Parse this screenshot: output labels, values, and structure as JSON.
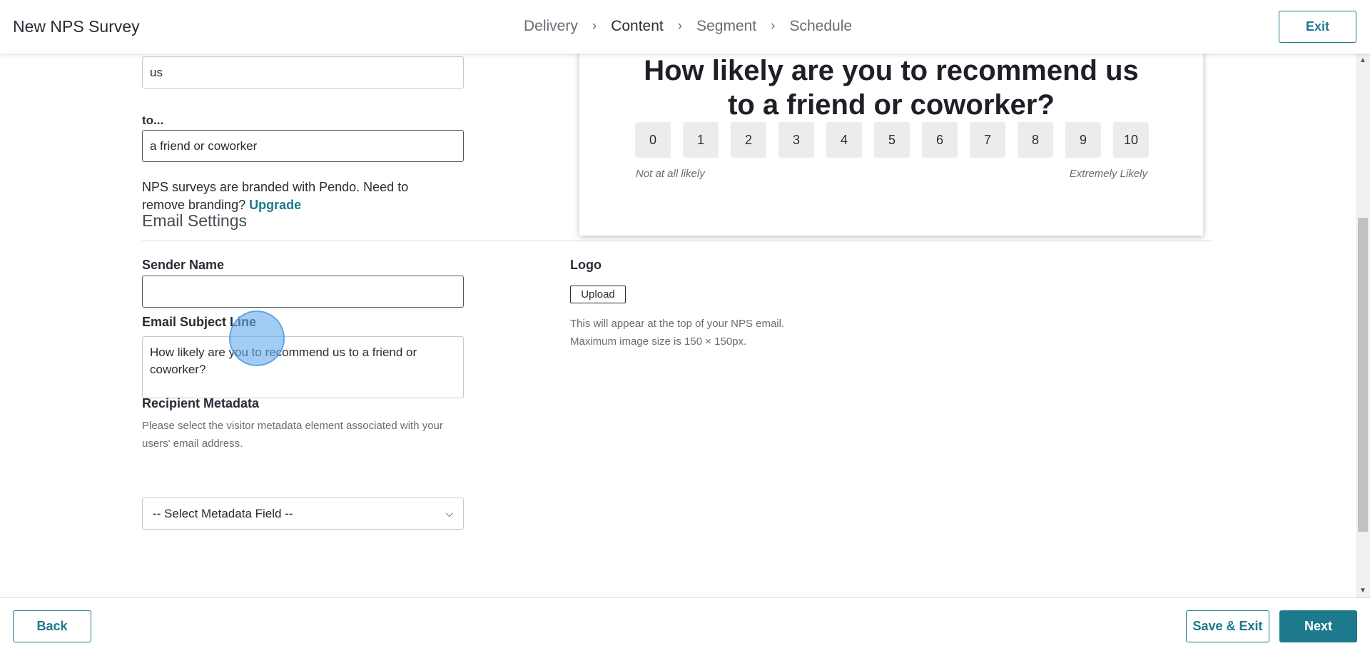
{
  "header": {
    "title": "New NPS Survey",
    "steps": [
      "Delivery",
      "Content",
      "Segment",
      "Schedule"
    ],
    "active_step": "Content",
    "exit_label": "Exit"
  },
  "form": {
    "about_value": "us",
    "to_label": "to...",
    "to_value": "a friend or coworker",
    "branding_note": "NPS surveys are branded with Pendo. Need to remove branding?",
    "upgrade_link": "Upgrade"
  },
  "preview": {
    "question_line1": "How likely are you to recommend us",
    "question_line2": "to a friend or coworker?",
    "scale": [
      "0",
      "1",
      "2",
      "3",
      "4",
      "5",
      "6",
      "7",
      "8",
      "9",
      "10"
    ],
    "low_label": "Not at all likely",
    "high_label": "Extremely Likely"
  },
  "email_settings": {
    "section_title": "Email Settings",
    "sender_name_label": "Sender Name",
    "sender_name_value": "",
    "subject_label": "Email Subject Line",
    "subject_value": "How likely are you to recommend us to a friend or coworker?",
    "recipient_label": "Recipient Metadata",
    "recipient_help": "Please select the visitor metadata element associated with your users' email address.",
    "recipient_select": "-- Select Metadata Field --",
    "logo_label": "Logo",
    "upload_label": "Upload",
    "logo_help_line1": "This will appear at the top of your NPS email.",
    "logo_help_line2": "Maximum image size is 150 × 150px."
  },
  "footer": {
    "back_label": "Back",
    "save_exit_label": "Save & Exit",
    "next_label": "Next"
  },
  "colors": {
    "accent": "#1d7a8c",
    "text": "#2a2c35",
    "muted": "#6a6c75"
  }
}
